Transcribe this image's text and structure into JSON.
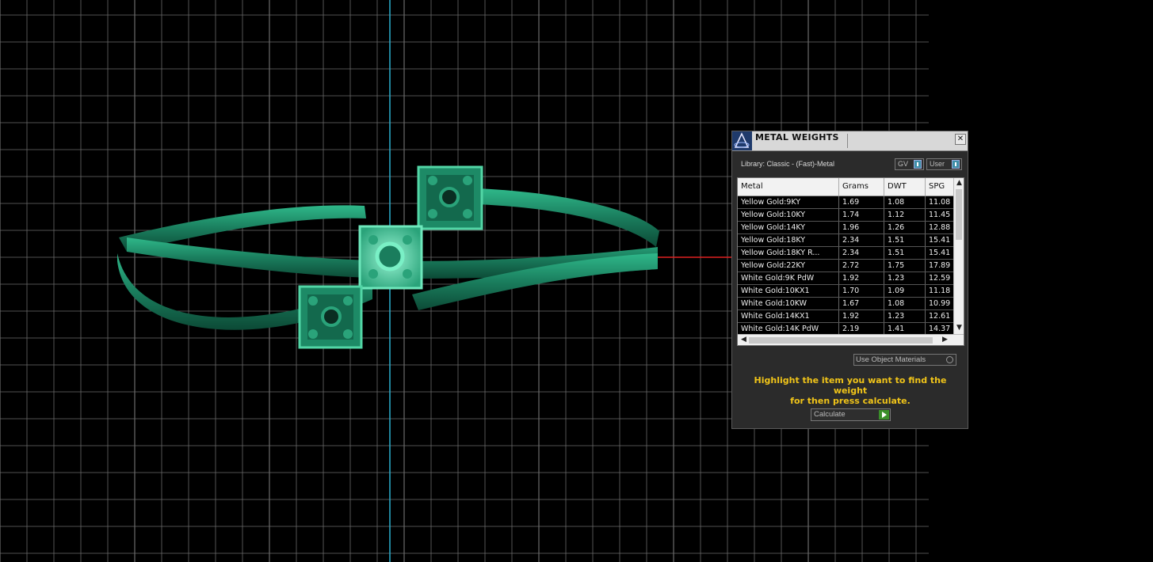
{
  "viewport": {
    "object_color": "#1f8f6a",
    "grid_color": "#6b6b6b",
    "y_axis_color": "#2ab0d0",
    "x_axis_color": "#e02020"
  },
  "panel": {
    "title": "METAL WEIGHTS",
    "close_label": "✕",
    "library_label": "Library: Classic - (Fast)-Metal",
    "gv_label": "GV",
    "user_label": "User",
    "table": {
      "columns": [
        "Metal",
        "Grams",
        "DWT",
        "SPG"
      ],
      "rows": [
        {
          "metal": "Yellow Gold:9KY",
          "grams": "1.69",
          "dwt": "1.08",
          "spg": "11.08"
        },
        {
          "metal": "Yellow Gold:10KY",
          "grams": "1.74",
          "dwt": "1.12",
          "spg": "11.45"
        },
        {
          "metal": "Yellow Gold:14KY",
          "grams": "1.96",
          "dwt": "1.26",
          "spg": "12.88"
        },
        {
          "metal": "Yellow Gold:18KY",
          "grams": "2.34",
          "dwt": "1.51",
          "spg": "15.41"
        },
        {
          "metal": "Yellow Gold:18KY R...",
          "grams": "2.34",
          "dwt": "1.51",
          "spg": "15.41"
        },
        {
          "metal": "Yellow Gold:22KY",
          "grams": "2.72",
          "dwt": "1.75",
          "spg": "17.89"
        },
        {
          "metal": "White Gold:9K PdW",
          "grams": "1.92",
          "dwt": "1.23",
          "spg": "12.59"
        },
        {
          "metal": "White Gold:10KX1",
          "grams": "1.70",
          "dwt": "1.09",
          "spg": "11.18"
        },
        {
          "metal": "White Gold:10KW",
          "grams": "1.67",
          "dwt": "1.08",
          "spg": "10.99"
        },
        {
          "metal": "White Gold:14KX1",
          "grams": "1.92",
          "dwt": "1.23",
          "spg": "12.61"
        },
        {
          "metal": "White Gold:14K PdW",
          "grams": "2.19",
          "dwt": "1.41",
          "spg": "14.37"
        }
      ]
    },
    "use_object_materials": "Use Object Materials",
    "instruction_line1": "Highlight the item you want to find the weight",
    "instruction_line2": "for then press calculate.",
    "calculate_label": "Calculate"
  }
}
